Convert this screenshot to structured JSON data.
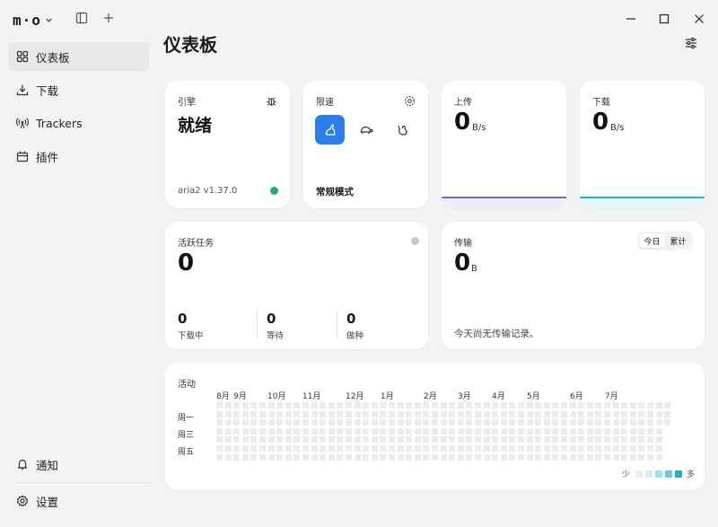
{
  "app": {
    "logo": "m·o"
  },
  "sidebar": {
    "items": [
      {
        "label": "仪表板",
        "icon": "dashboard-icon",
        "active": true
      },
      {
        "label": "下载",
        "icon": "download-icon",
        "active": false
      },
      {
        "label": "Trackers",
        "icon": "antenna-icon",
        "active": false
      },
      {
        "label": "插件",
        "icon": "plugin-icon",
        "active": false
      }
    ],
    "bottom": [
      {
        "label": "通知",
        "icon": "bell-icon"
      },
      {
        "label": "设置",
        "icon": "gear-icon"
      }
    ]
  },
  "page": {
    "title": "仪表板"
  },
  "engine": {
    "label": "引擎",
    "status": "就绪",
    "version": "aria2 v1.37.0",
    "status_color": "#1fae6e"
  },
  "speed_limit": {
    "label": "限速",
    "mode": "常规模式",
    "accent": "#2b7de9"
  },
  "upload": {
    "label": "上传",
    "value": "0",
    "unit": "B/s",
    "line_color": "#7b61d6"
  },
  "download": {
    "label": "下载",
    "value": "0",
    "unit": "B/s",
    "line_color": "#23b5d3"
  },
  "active_tasks": {
    "label": "活跃任务",
    "count": "0",
    "stats": [
      {
        "value": "0",
        "label": "下载中"
      },
      {
        "value": "0",
        "label": "等待"
      },
      {
        "value": "0",
        "label": "做种"
      }
    ]
  },
  "transfer": {
    "label": "传输",
    "value": "0",
    "unit": "B",
    "tabs": [
      "今日",
      "累计"
    ],
    "selected_tab": "今日",
    "empty_message": "今天尚无传输记录。"
  },
  "activity": {
    "label": "活动",
    "months": [
      "8月",
      "9月",
      "10月",
      "11月",
      "12月",
      "1月",
      "2月",
      "3月",
      "4月",
      "5月",
      "6月",
      "7月"
    ],
    "days": [
      "周一",
      "周三",
      "周五"
    ],
    "legend_less": "少",
    "legend_more": "多",
    "legend_colors": [
      "#ececec",
      "#cdeef5",
      "#9adfeb",
      "#5fc9dd",
      "#27aec7"
    ]
  }
}
